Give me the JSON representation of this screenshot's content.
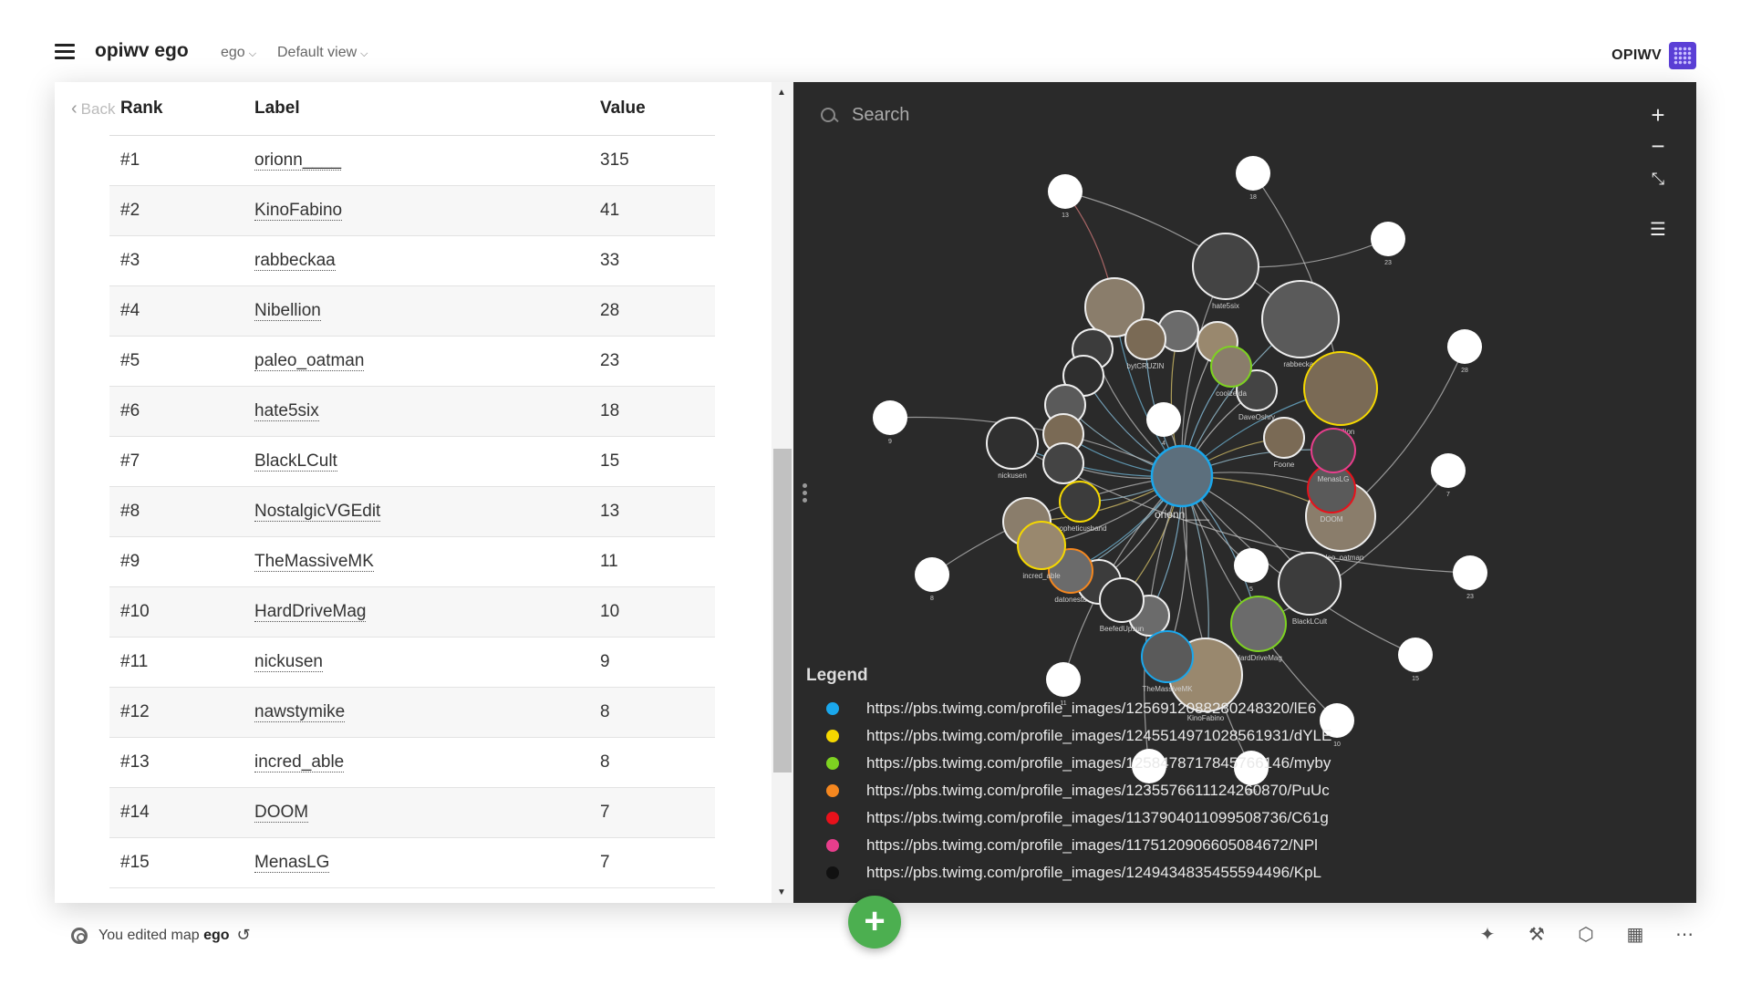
{
  "header": {
    "title": "opiwv ego",
    "map_dropdown": "ego",
    "view_dropdown": "Default view",
    "brand": "OPIWV"
  },
  "table": {
    "back_label": "Back",
    "columns": [
      "Rank",
      "Label",
      "Value"
    ],
    "rows": [
      {
        "rank": "#1",
        "label": "orionn____",
        "value": "315"
      },
      {
        "rank": "#2",
        "label": "KinoFabino",
        "value": "41"
      },
      {
        "rank": "#3",
        "label": "rabbeckaa",
        "value": "33"
      },
      {
        "rank": "#4",
        "label": "Nibellion",
        "value": "28"
      },
      {
        "rank": "#5",
        "label": "paleo_oatman",
        "value": "23"
      },
      {
        "rank": "#6",
        "label": "hate5six",
        "value": "18"
      },
      {
        "rank": "#7",
        "label": "BlackLCult",
        "value": "15"
      },
      {
        "rank": "#8",
        "label": "NostalgicVGEdit",
        "value": "13"
      },
      {
        "rank": "#9",
        "label": "TheMassiveMK",
        "value": "11"
      },
      {
        "rank": "#10",
        "label": "HardDriveMag",
        "value": "10"
      },
      {
        "rank": "#11",
        "label": "nickusen",
        "value": "9"
      },
      {
        "rank": "#12",
        "label": "nawstymike",
        "value": "8"
      },
      {
        "rank": "#13",
        "label": "incred_able",
        "value": "8"
      },
      {
        "rank": "#14",
        "label": "DOOM",
        "value": "7"
      },
      {
        "rank": "#15",
        "label": "MenasLG",
        "value": "7"
      }
    ]
  },
  "graph": {
    "search_placeholder": "Search",
    "controls": {
      "zoom_in": "+",
      "zoom_out": "−"
    },
    "center_label": "orionn____",
    "legend_title": "Legend",
    "legend": [
      {
        "color": "#1aa7ec",
        "text": "https://pbs.twimg.com/profile_images/1256912088280248320/lE6"
      },
      {
        "color": "#f5d800",
        "text": "https://pbs.twimg.com/profile_images/1245514971028561931/dYLE"
      },
      {
        "color": "#7ed321",
        "text": "https://pbs.twimg.com/profile_images/1258478717845766146/myby"
      },
      {
        "color": "#f5871f",
        "text": "https://pbs.twimg.com/profile_images/1235576611124260870/PuUc"
      },
      {
        "color": "#e8111b",
        "text": "https://pbs.twimg.com/profile_images/1137904011099508736/C61g"
      },
      {
        "color": "#e83e8c",
        "text": "https://pbs.twimg.com/profile_images/1175120906605084672/NPl"
      },
      {
        "color": "#111111",
        "text": "https://pbs.twimg.com/profile_images/1249434835455594496/KpL"
      }
    ],
    "nodes": [
      {
        "label": "rabbeckaa"
      },
      {
        "label": "Nibellion"
      },
      {
        "label": "hate5six"
      },
      {
        "label": "paleo_oatman"
      },
      {
        "label": "BlackLCult"
      },
      {
        "label": "HardDriveMag"
      },
      {
        "label": "KinoFabino"
      },
      {
        "label": "nickusen"
      },
      {
        "label": "DOOM"
      },
      {
        "label": "Foone"
      },
      {
        "label": "DaveOshry"
      },
      {
        "label": "coolzelda"
      },
      {
        "label": "propheticusband"
      },
      {
        "label": "datonesta"
      },
      {
        "label": "incred_able"
      },
      {
        "label": "BeefedUpsun"
      },
      {
        "label": "TheMassiveMK"
      },
      {
        "label": "bytCRUZIN"
      },
      {
        "label": "MenasLG"
      }
    ],
    "white_node_labels": [
      "13",
      "18",
      "23",
      "28",
      "9",
      "7",
      "8",
      "23",
      "15",
      "10",
      "5",
      "6",
      "11",
      "4",
      "285"
    ]
  },
  "footer": {
    "status_prefix": "You edited map",
    "status_map": "ego",
    "fab_label": "+"
  },
  "colors": {
    "graph_bg": "#2a2a2a",
    "center_ring": "#1aa7ec",
    "fab": "#4caf50",
    "brand": "#5b3fd6"
  }
}
